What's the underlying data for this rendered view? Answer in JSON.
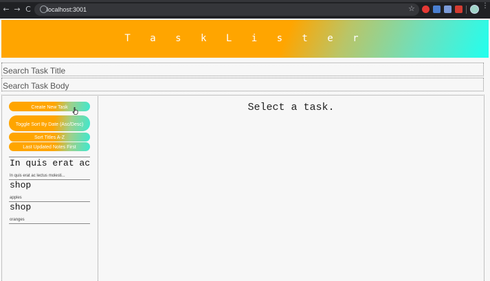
{
  "browser": {
    "url": "localhost:3001",
    "back_glyph": "←",
    "forward_glyph": "→",
    "reload_glyph": "C",
    "star_glyph": "☆",
    "menu_glyph": "⋮"
  },
  "header": {
    "title": "T a s k L i s t e r"
  },
  "search": {
    "title_placeholder": "Search Task Title",
    "body_placeholder": "Search Task Body"
  },
  "sidebar": {
    "buttons": {
      "create": "Create New Task",
      "toggle_sort": "Toggle Sort By Date (Asc/Desc)",
      "sort_titles": "Sort Titles A-Z",
      "last_updated": "Last Updated Notes First"
    },
    "tasks": [
      {
        "title": "In quis erat ac",
        "body": "In quis erat ac lectus molesti..."
      },
      {
        "title": "shop",
        "body": "apples"
      },
      {
        "title": "shop",
        "body": "oranges"
      }
    ]
  },
  "main": {
    "placeholder": "Select a task."
  },
  "colors": {
    "accent": "#ffa500",
    "gradient_end": "#22ffee"
  }
}
